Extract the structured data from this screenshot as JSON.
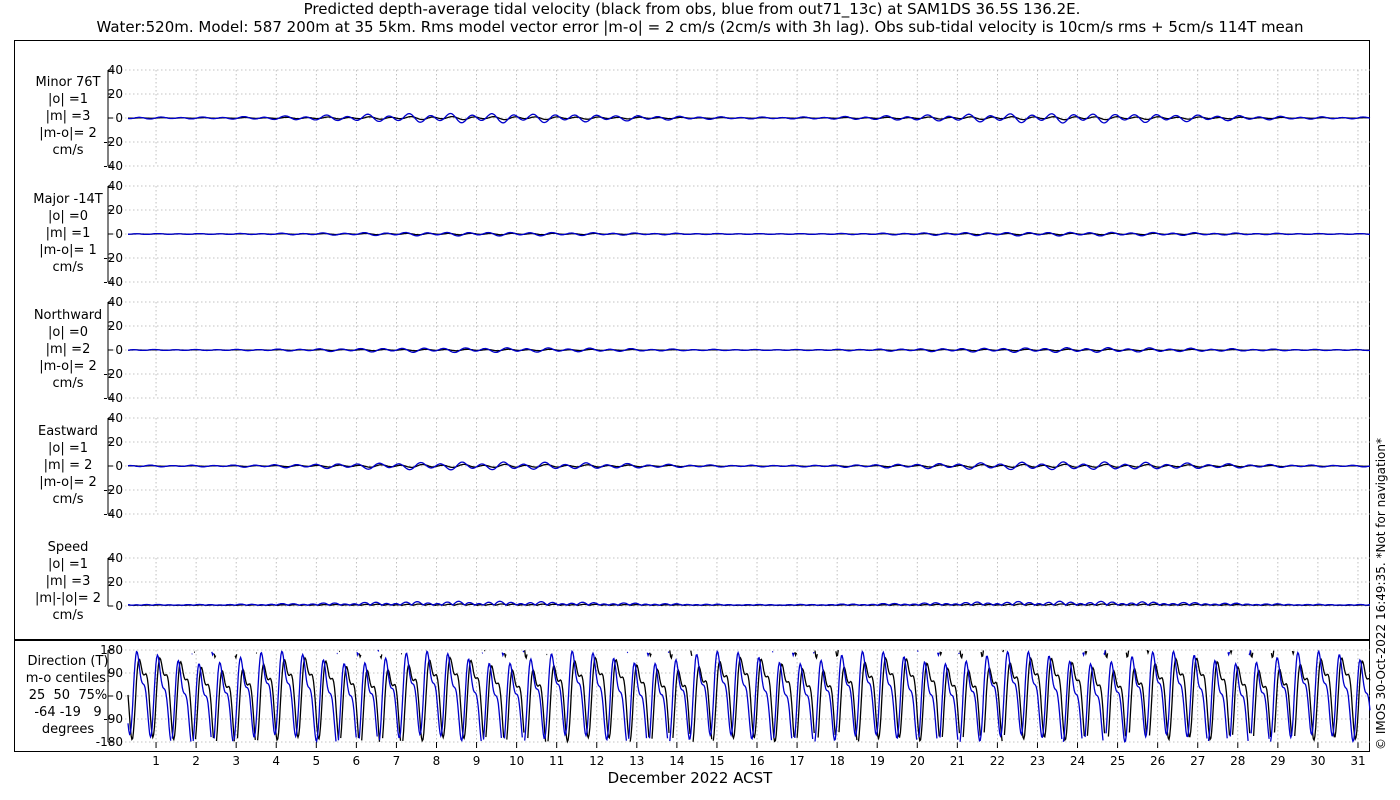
{
  "title": {
    "line1": "Predicted depth-average tidal velocity (black from obs, blue from out71_13c) at SAM1DS 36.5S 136.2E.",
    "line2": "Water:520m. Model: 587 200m at 35 5km. Rms model vector error |m-o| = 2 cm/s (2cm/s with 3h lag). Obs sub-tidal velocity is 10cm/s rms + 5cm/s 114T mean"
  },
  "xlabel": "December 2022 ACST",
  "credit": "© IMOS 30-Oct-2022 16:49:35.  *Not for navigation*",
  "colors": {
    "obs": "#000000",
    "model": "#0000cc",
    "grid": "#b0b0b0"
  },
  "chart_data": [
    {
      "type": "line",
      "name": "minor",
      "label_lines": [
        "Minor 76T",
        "|o| =1",
        "|m| =3",
        "|m-o|= 2",
        "cm/s"
      ],
      "ylim": [
        -40,
        40
      ],
      "yticks": [
        40,
        20,
        0,
        -20,
        -40
      ],
      "series": [
        {
          "name": "obs",
          "color": "#000000",
          "amplitude": 1
        },
        {
          "name": "model",
          "color": "#0000cc",
          "amplitude": 3
        }
      ]
    },
    {
      "type": "line",
      "name": "major",
      "label_lines": [
        "Major -14T",
        "|o| =0",
        "|m| =1",
        "|m-o|= 1",
        "cm/s"
      ],
      "ylim": [
        -40,
        40
      ],
      "yticks": [
        40,
        20,
        0,
        -20,
        -40
      ],
      "series": [
        {
          "name": "obs",
          "color": "#000000",
          "amplitude": 0.5
        },
        {
          "name": "model",
          "color": "#0000cc",
          "amplitude": 1.2
        }
      ]
    },
    {
      "type": "line",
      "name": "northward",
      "label_lines": [
        "Northward",
        "|o| =0",
        "|m| =2",
        "|m-o|= 2",
        "cm/s"
      ],
      "ylim": [
        -40,
        40
      ],
      "yticks": [
        40,
        20,
        0,
        -20,
        -40
      ],
      "series": [
        {
          "name": "obs",
          "color": "#000000",
          "amplitude": 0.5
        },
        {
          "name": "model",
          "color": "#0000cc",
          "amplitude": 1.5
        }
      ]
    },
    {
      "type": "line",
      "name": "eastward",
      "label_lines": [
        "Eastward",
        "|o| =1",
        "|m| = 2",
        "|m-o|= 2",
        "cm/s"
      ],
      "ylim": [
        -40,
        40
      ],
      "yticks": [
        40,
        20,
        0,
        -20,
        -40
      ],
      "series": [
        {
          "name": "obs",
          "color": "#000000",
          "amplitude": 1
        },
        {
          "name": "model",
          "color": "#0000cc",
          "amplitude": 2.5
        }
      ]
    },
    {
      "type": "line",
      "name": "speed",
      "label_lines": [
        "Speed",
        "|o| =1",
        "|m| =3",
        "|m|-|o|= 2",
        "cm/s"
      ],
      "ylim": [
        0,
        40
      ],
      "yticks": [
        40,
        20,
        0
      ],
      "series": [
        {
          "name": "obs",
          "color": "#000000",
          "amplitude": 1
        },
        {
          "name": "model",
          "color": "#0000cc",
          "amplitude": 3
        }
      ]
    },
    {
      "type": "line",
      "name": "direction",
      "label_lines": [
        "Direction (T)",
        "m-o centiles:",
        "25  50  75%",
        "-64 -19   9",
        "degrees"
      ],
      "ylim": [
        -180,
        180
      ],
      "yticks": [
        180,
        90,
        0,
        -90,
        -180
      ],
      "series": [
        {
          "name": "obs",
          "color": "#000000"
        },
        {
          "name": "model",
          "color": "#0000cc"
        }
      ]
    }
  ],
  "x_axis": {
    "tick_labels": [
      "1",
      "2",
      "3",
      "4",
      "5",
      "6",
      "7",
      "8",
      "9",
      "10",
      "11",
      "12",
      "13",
      "14",
      "15",
      "16",
      "17",
      "18",
      "19",
      "20",
      "21",
      "22",
      "23",
      "24",
      "25",
      "26",
      "27",
      "28",
      "29",
      "30",
      "31"
    ],
    "xlim": [
      0.3,
      31.3
    ]
  }
}
